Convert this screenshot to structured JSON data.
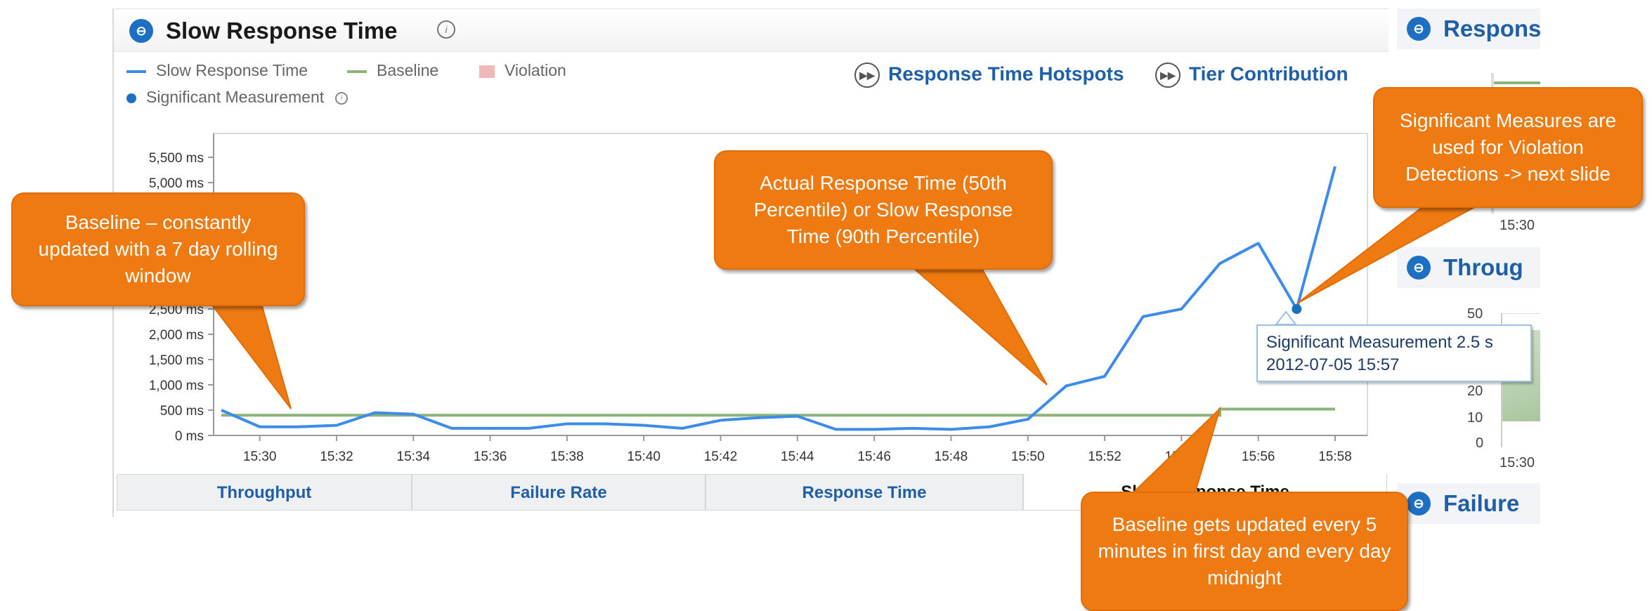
{
  "panel": {
    "title": "Slow Response Time",
    "legend": {
      "slow_response_time": "Slow Response Time",
      "baseline": "Baseline",
      "violation": "Violation",
      "significant_measurement": "Significant Measurement"
    },
    "links": {
      "hotspots": "Response Time Hotspots",
      "tier_contribution": "Tier Contribution"
    }
  },
  "colors": {
    "series_blue": "#3d8bea",
    "baseline_green": "#8ab47a",
    "violation_pink": "#f2b7b7",
    "callout_orange": "#ee7a11",
    "link_blue": "#1f5fa8"
  },
  "chart_data": {
    "type": "line",
    "y_ticks": [
      "5,500 ms",
      "5,000 ms",
      "2,500 ms",
      "2,000 ms",
      "1,500 ms",
      "1,000 ms",
      "500 ms",
      "0 ms"
    ],
    "y_tick_values": [
      5500,
      5000,
      2500,
      2000,
      1500,
      1000,
      500,
      0
    ],
    "x_ticks": [
      "15:30",
      "15:32",
      "15:34",
      "15:36",
      "15:38",
      "15:40",
      "15:42",
      "15:44",
      "15:46",
      "15:48",
      "15:50",
      "15:52",
      "15:54",
      "15:56",
      "15:58"
    ],
    "ylim": [
      0,
      6000
    ],
    "xlim": [
      "15:29",
      "15:58"
    ],
    "grid": false,
    "legend_position": "top-left",
    "series": [
      {
        "name": "Slow Response Time",
        "x": [
          "15:29",
          "15:30",
          "15:31",
          "15:32",
          "15:33",
          "15:34",
          "15:35",
          "15:36",
          "15:37",
          "15:38",
          "15:39",
          "15:40",
          "15:41",
          "15:42",
          "15:43",
          "15:44",
          "15:45",
          "15:46",
          "15:47",
          "15:48",
          "15:49",
          "15:50",
          "15:51",
          "15:52",
          "15:53",
          "15:54",
          "15:55",
          "15:56",
          "15:57",
          "15:58"
        ],
        "values": [
          500,
          170,
          170,
          200,
          450,
          420,
          140,
          140,
          140,
          230,
          230,
          200,
          140,
          300,
          350,
          380,
          120,
          120,
          140,
          120,
          170,
          320,
          980,
          1170,
          2350,
          2500,
          3400,
          3800,
          2500,
          5320
        ]
      },
      {
        "name": "Baseline",
        "x": [
          "15:29",
          "15:55",
          "15:55",
          "15:58"
        ],
        "values": [
          400,
          400,
          520,
          520
        ]
      }
    ],
    "significant_measurement": {
      "x": "15:57",
      "value": 2500
    }
  },
  "tooltip": {
    "line1": "Significant Measurement 2.5 s",
    "line2": "2012-07-05 15:57"
  },
  "tabs": [
    "Throughput",
    "Failure Rate",
    "Response Time",
    "Slow Response Time"
  ],
  "right_panel": {
    "titles": [
      "Respons",
      "Throug",
      "Failure"
    ],
    "ticks": [
      "15:30",
      "50",
      "20",
      "10",
      "0",
      "15:30"
    ]
  },
  "callouts": {
    "baseline": "Baseline – constantly updated with a 7 day rolling window",
    "actual": "Actual Response Time (50th Percentile) or Slow Response Time (90th Percentile)",
    "significant": "Significant Measures are used for Violation Detections -> next slide",
    "update": "Baseline gets updated every 5 minutes in first day and every day midnight"
  }
}
